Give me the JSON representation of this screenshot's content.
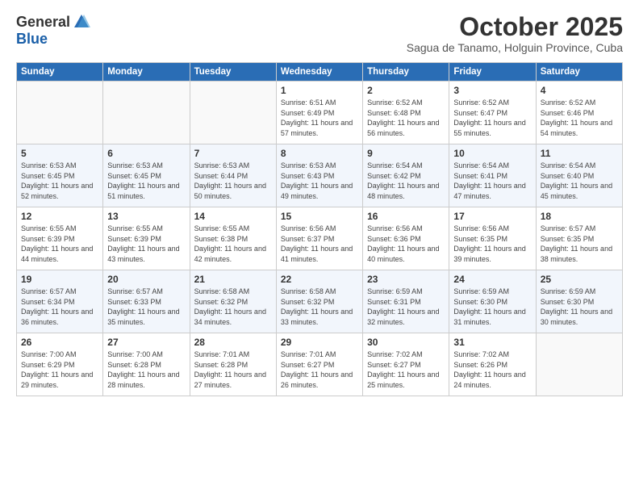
{
  "logo": {
    "general": "General",
    "blue": "Blue"
  },
  "header": {
    "month_title": "October 2025",
    "subtitle": "Sagua de Tanamo, Holguin Province, Cuba"
  },
  "days_of_week": [
    "Sunday",
    "Monday",
    "Tuesday",
    "Wednesday",
    "Thursday",
    "Friday",
    "Saturday"
  ],
  "weeks": [
    {
      "shade": false,
      "days": [
        {
          "num": "",
          "data": ""
        },
        {
          "num": "",
          "data": ""
        },
        {
          "num": "",
          "data": ""
        },
        {
          "num": "1",
          "data": "Sunrise: 6:51 AM\nSunset: 6:49 PM\nDaylight: 11 hours and 57 minutes."
        },
        {
          "num": "2",
          "data": "Sunrise: 6:52 AM\nSunset: 6:48 PM\nDaylight: 11 hours and 56 minutes."
        },
        {
          "num": "3",
          "data": "Sunrise: 6:52 AM\nSunset: 6:47 PM\nDaylight: 11 hours and 55 minutes."
        },
        {
          "num": "4",
          "data": "Sunrise: 6:52 AM\nSunset: 6:46 PM\nDaylight: 11 hours and 54 minutes."
        }
      ]
    },
    {
      "shade": true,
      "days": [
        {
          "num": "5",
          "data": "Sunrise: 6:53 AM\nSunset: 6:45 PM\nDaylight: 11 hours and 52 minutes."
        },
        {
          "num": "6",
          "data": "Sunrise: 6:53 AM\nSunset: 6:45 PM\nDaylight: 11 hours and 51 minutes."
        },
        {
          "num": "7",
          "data": "Sunrise: 6:53 AM\nSunset: 6:44 PM\nDaylight: 11 hours and 50 minutes."
        },
        {
          "num": "8",
          "data": "Sunrise: 6:53 AM\nSunset: 6:43 PM\nDaylight: 11 hours and 49 minutes."
        },
        {
          "num": "9",
          "data": "Sunrise: 6:54 AM\nSunset: 6:42 PM\nDaylight: 11 hours and 48 minutes."
        },
        {
          "num": "10",
          "data": "Sunrise: 6:54 AM\nSunset: 6:41 PM\nDaylight: 11 hours and 47 minutes."
        },
        {
          "num": "11",
          "data": "Sunrise: 6:54 AM\nSunset: 6:40 PM\nDaylight: 11 hours and 45 minutes."
        }
      ]
    },
    {
      "shade": false,
      "days": [
        {
          "num": "12",
          "data": "Sunrise: 6:55 AM\nSunset: 6:39 PM\nDaylight: 11 hours and 44 minutes."
        },
        {
          "num": "13",
          "data": "Sunrise: 6:55 AM\nSunset: 6:39 PM\nDaylight: 11 hours and 43 minutes."
        },
        {
          "num": "14",
          "data": "Sunrise: 6:55 AM\nSunset: 6:38 PM\nDaylight: 11 hours and 42 minutes."
        },
        {
          "num": "15",
          "data": "Sunrise: 6:56 AM\nSunset: 6:37 PM\nDaylight: 11 hours and 41 minutes."
        },
        {
          "num": "16",
          "data": "Sunrise: 6:56 AM\nSunset: 6:36 PM\nDaylight: 11 hours and 40 minutes."
        },
        {
          "num": "17",
          "data": "Sunrise: 6:56 AM\nSunset: 6:35 PM\nDaylight: 11 hours and 39 minutes."
        },
        {
          "num": "18",
          "data": "Sunrise: 6:57 AM\nSunset: 6:35 PM\nDaylight: 11 hours and 38 minutes."
        }
      ]
    },
    {
      "shade": true,
      "days": [
        {
          "num": "19",
          "data": "Sunrise: 6:57 AM\nSunset: 6:34 PM\nDaylight: 11 hours and 36 minutes."
        },
        {
          "num": "20",
          "data": "Sunrise: 6:57 AM\nSunset: 6:33 PM\nDaylight: 11 hours and 35 minutes."
        },
        {
          "num": "21",
          "data": "Sunrise: 6:58 AM\nSunset: 6:32 PM\nDaylight: 11 hours and 34 minutes."
        },
        {
          "num": "22",
          "data": "Sunrise: 6:58 AM\nSunset: 6:32 PM\nDaylight: 11 hours and 33 minutes."
        },
        {
          "num": "23",
          "data": "Sunrise: 6:59 AM\nSunset: 6:31 PM\nDaylight: 11 hours and 32 minutes."
        },
        {
          "num": "24",
          "data": "Sunrise: 6:59 AM\nSunset: 6:30 PM\nDaylight: 11 hours and 31 minutes."
        },
        {
          "num": "25",
          "data": "Sunrise: 6:59 AM\nSunset: 6:30 PM\nDaylight: 11 hours and 30 minutes."
        }
      ]
    },
    {
      "shade": false,
      "days": [
        {
          "num": "26",
          "data": "Sunrise: 7:00 AM\nSunset: 6:29 PM\nDaylight: 11 hours and 29 minutes."
        },
        {
          "num": "27",
          "data": "Sunrise: 7:00 AM\nSunset: 6:28 PM\nDaylight: 11 hours and 28 minutes."
        },
        {
          "num": "28",
          "data": "Sunrise: 7:01 AM\nSunset: 6:28 PM\nDaylight: 11 hours and 27 minutes."
        },
        {
          "num": "29",
          "data": "Sunrise: 7:01 AM\nSunset: 6:27 PM\nDaylight: 11 hours and 26 minutes."
        },
        {
          "num": "30",
          "data": "Sunrise: 7:02 AM\nSunset: 6:27 PM\nDaylight: 11 hours and 25 minutes."
        },
        {
          "num": "31",
          "data": "Sunrise: 7:02 AM\nSunset: 6:26 PM\nDaylight: 11 hours and 24 minutes."
        },
        {
          "num": "",
          "data": ""
        }
      ]
    }
  ]
}
